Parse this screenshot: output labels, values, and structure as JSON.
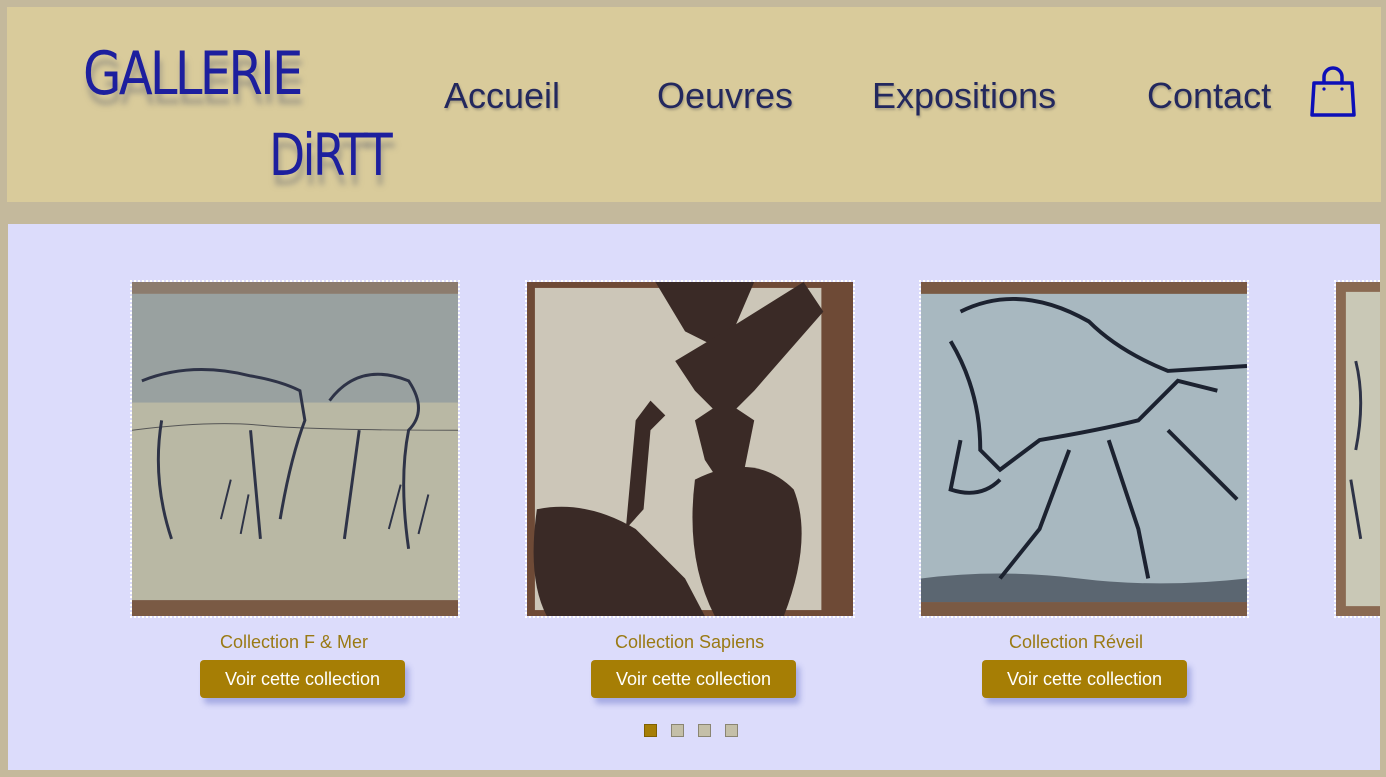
{
  "brand": {
    "line1": "GALLERIE",
    "line2": "DiRTT"
  },
  "nav": {
    "items": [
      "Accueil",
      "Oeuvres",
      "Expositions",
      "Contact"
    ],
    "cart_icon": "shopping-bag-icon"
  },
  "collections": [
    {
      "title": "Collection F & Mer",
      "button": "Voir cette collection",
      "artwork": "bears-drawing-on-wood"
    },
    {
      "title": "Collection Sapiens",
      "button": "Voir cette collection",
      "artwork": "herons-drawing-on-wood"
    },
    {
      "title": "Collection Réveil",
      "button": "Voir cette collection",
      "artwork": "moose-drawing-on-wood"
    }
  ],
  "carousel": {
    "pages": 4,
    "active_page": 1
  },
  "colors": {
    "header_bg": "#d9cb9b",
    "main_bg": "#dcdcfb",
    "accent": "#a67e05",
    "logo": "#1d1f9e",
    "nav_text": "#23285e"
  }
}
